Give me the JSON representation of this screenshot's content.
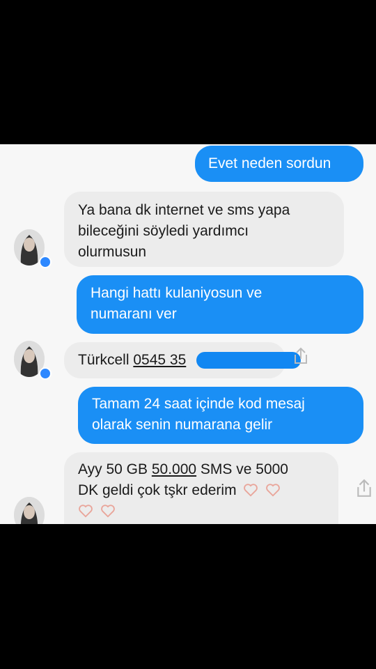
{
  "messages": [
    {
      "side": "sent",
      "text": "Evet neden sordun"
    },
    {
      "side": "received",
      "lines": [
        "Ya bana dk internet ve sms yapa",
        "bileceğini söyledi yardımcı",
        "olurmusun"
      ]
    },
    {
      "side": "sent",
      "lines": [
        "Hangi hattı kulaniyosun ve",
        "numaranı ver"
      ]
    },
    {
      "side": "received",
      "operator": "Türkcell",
      "number_visible": "0545 35"
    },
    {
      "side": "sent",
      "lines": [
        "Tamam 24 saat içinde kod mesaj",
        "olarak senin numarana gelir"
      ]
    },
    {
      "side": "received",
      "parts": [
        "Ayy 50 GB ",
        "50.000",
        " SMS ve 5000"
      ],
      "line2": "DK geldi çok tşkr ederim"
    }
  ],
  "colors": {
    "sent": "#1a8ff5",
    "received": "#ececec",
    "background": "#f7f7f7"
  },
  "icons": [
    "avatar",
    "messenger-badge-icon",
    "share-icon",
    "heart-icon"
  ]
}
